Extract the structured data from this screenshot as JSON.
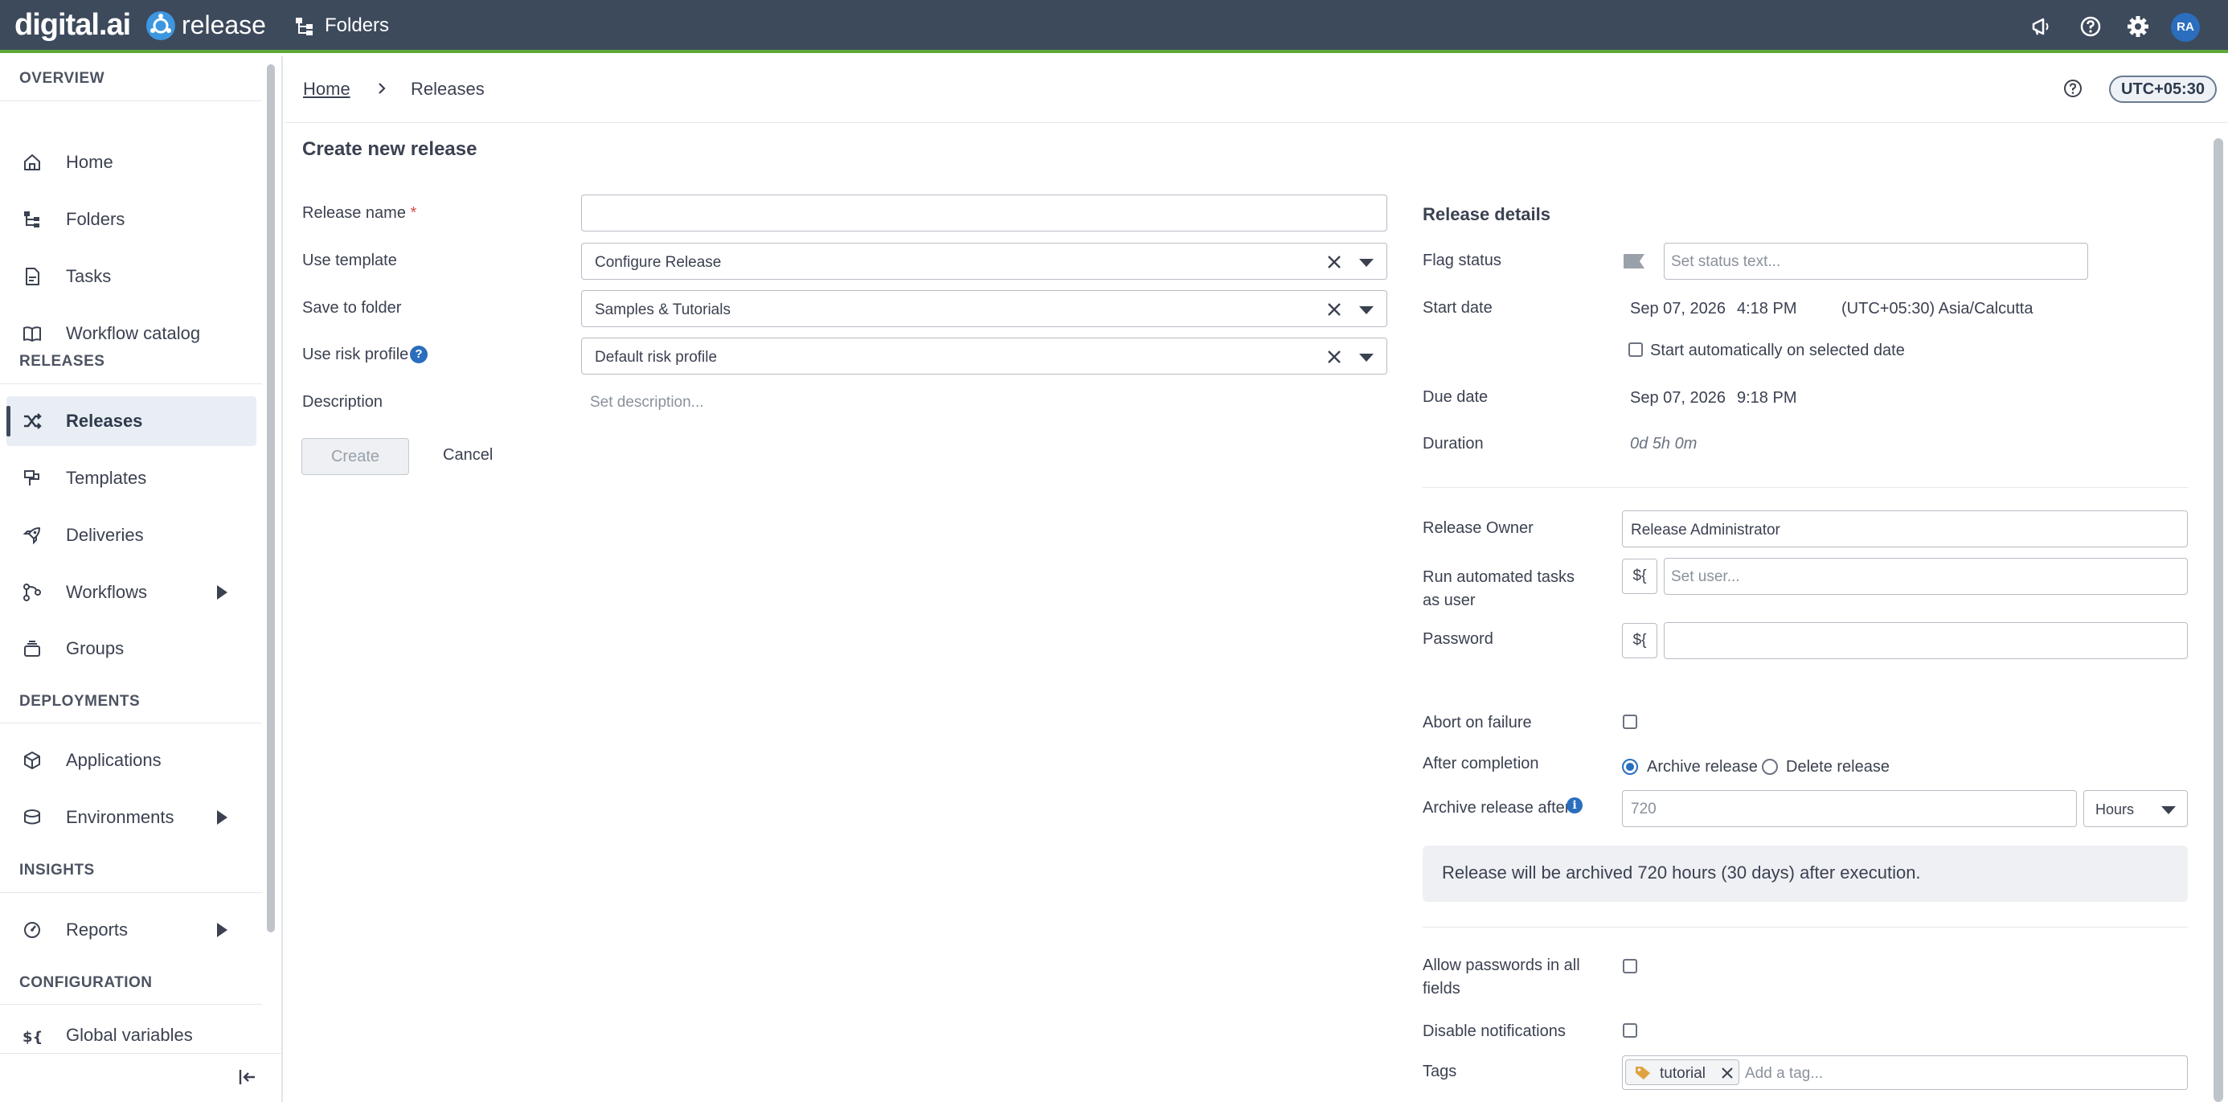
{
  "topbar": {
    "brand": "digital.ai",
    "product": "release",
    "nav_label": "Folders",
    "avatar_initials": "RA"
  },
  "sidebar": {
    "overview_label": "OVERVIEW",
    "overview_items": [
      {
        "label": "Home",
        "icon": "home-icon"
      },
      {
        "label": "Folders",
        "icon": "folders-icon"
      },
      {
        "label": "Tasks",
        "icon": "tasks-icon"
      },
      {
        "label": "Workflow catalog",
        "icon": "book-icon"
      }
    ],
    "releases_label": "RELEASES",
    "releases_items": [
      {
        "label": "Releases",
        "icon": "shuffle-icon",
        "active": true
      },
      {
        "label": "Templates",
        "icon": "template-icon"
      },
      {
        "label": "Deliveries",
        "icon": "rocket-icon"
      },
      {
        "label": "Workflows",
        "icon": "workflow-icon",
        "expandable": true
      },
      {
        "label": "Groups",
        "icon": "groups-icon"
      }
    ],
    "deployments_label": "DEPLOYMENTS",
    "deployments_items": [
      {
        "label": "Applications",
        "icon": "cube-icon"
      },
      {
        "label": "Environments",
        "icon": "environments-icon",
        "expandable": true
      }
    ],
    "insights_label": "INSIGHTS",
    "insights_items": [
      {
        "label": "Reports",
        "icon": "gauge-icon",
        "expandable": true
      }
    ],
    "configuration_label": "CONFIGURATION",
    "configuration_items": [
      {
        "label": "Global variables",
        "icon": "variable-icon"
      }
    ]
  },
  "header": {
    "breadcrumb_home": "Home",
    "breadcrumb_current": "Releases",
    "timezone": "UTC+05:30"
  },
  "form": {
    "title": "Create new release",
    "release_name_label": "Release name",
    "required_mark": "*",
    "release_name_value": "",
    "use_template_label": "Use template",
    "use_template_value": "Configure Release",
    "save_to_folder_label": "Save to folder",
    "save_to_folder_value": "Samples & Tutorials",
    "risk_profile_label": "Use risk profile",
    "risk_profile_value": "Default risk profile",
    "description_label": "Description",
    "description_placeholder": "Set description...",
    "create_label": "Create",
    "cancel_label": "Cancel"
  },
  "details": {
    "title": "Release details",
    "flag_status_label": "Flag status",
    "flag_status_placeholder": "Set status text...",
    "start_date_label": "Start date",
    "start_date": "Sep 07, 2026",
    "start_time": "4:18 PM",
    "start_timezone": "(UTC+05:30) Asia/Calcutta",
    "start_auto_label": "Start automatically on selected date",
    "start_auto_checked": false,
    "due_date_label": "Due date",
    "due_date": "Sep 07, 2026",
    "due_time": "9:18 PM",
    "duration_label": "Duration",
    "duration_value": "0d 5h 0m",
    "owner_label": "Release Owner",
    "owner_value": "Release Administrator",
    "run_as_label": "Run automated tasks as user",
    "run_as_placeholder": "Set user...",
    "variable_button": "${",
    "password_label": "Password",
    "abort_label": "Abort on failure",
    "abort_checked": false,
    "after_completion_label": "After completion",
    "archive_option": "Archive release",
    "delete_option": "Delete release",
    "selected_option": "archive",
    "archive_after_label": "Archive release after",
    "archive_after_placeholder": "720",
    "archive_unit": "Hours",
    "archive_note": "Release will be archived 720 hours (30 days) after execution.",
    "allow_passwords_label": "Allow passwords in all fields",
    "allow_passwords_checked": false,
    "disable_notifications_label": "Disable notifications",
    "disable_notifications_checked": false,
    "tags_label": "Tags",
    "tags": [
      "tutorial"
    ],
    "tag_placeholder": "Add a tag..."
  },
  "colors": {
    "topbar_bg": "#3d4a5c",
    "accent_green": "#5ea836",
    "primary_blue": "#2a6ebd"
  }
}
